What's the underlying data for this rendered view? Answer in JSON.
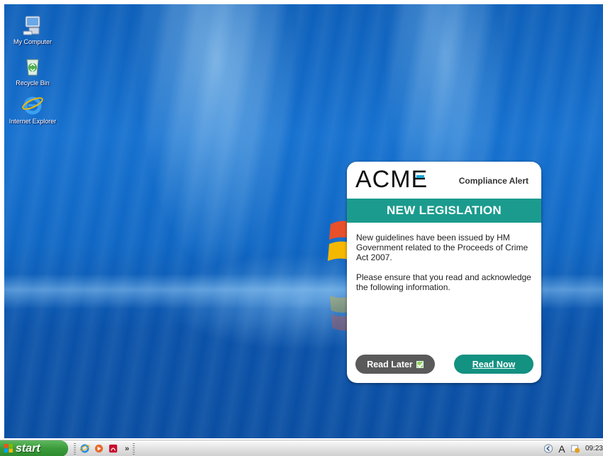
{
  "desktop": {
    "icons": [
      {
        "label": "My Computer",
        "icon": "computer-icon"
      },
      {
        "label": "Recycle Bin",
        "icon": "recycle-bin-icon"
      },
      {
        "label": "Internet Explorer",
        "icon": "internet-explorer-icon"
      }
    ]
  },
  "alert": {
    "logo": "ACME",
    "label": "Compliance Alert",
    "banner": "NEW LEGISLATION",
    "paragraphs": [
      "New guidelines have been issued by HM Government related to the Proceeds of Crime Act 2007.",
      "Please ensure that you read and acknowledge the following information."
    ],
    "read_later_label": "Read Later",
    "read_now_label": "Read Now",
    "accent_color": "#1b9b8e"
  },
  "taskbar": {
    "start_label": "start",
    "quick_launch_more": "»",
    "tray_letter": "A",
    "clock": "09:23"
  }
}
